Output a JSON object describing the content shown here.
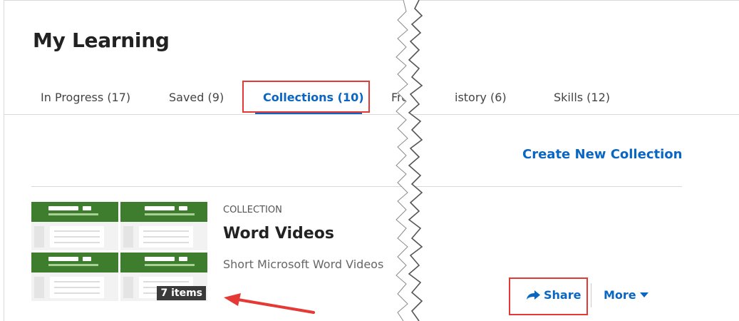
{
  "page": {
    "title": "My Learning"
  },
  "tabs": [
    {
      "label": "In Progress (17)"
    },
    {
      "label": "Saved (9)"
    },
    {
      "label": "Collections (10)",
      "active": true
    },
    {
      "label": "Fro"
    },
    {
      "label": "istory (6)"
    },
    {
      "label": "Skills (12)"
    }
  ],
  "actions": {
    "create_collection": "Create New Collection"
  },
  "collection": {
    "kind": "COLLECTION",
    "title": "Word Videos",
    "description": "Short Microsoft Word Videos",
    "items_badge": "7 items",
    "share_label": "Share",
    "more_label": "More"
  },
  "colors": {
    "accent": "#0a66c2",
    "highlight": "#e53935",
    "thumbnail_ribbon": "#3f7d2e"
  },
  "icons": [
    "share-arrow-icon",
    "caret-down-icon",
    "annotation-arrow"
  ]
}
